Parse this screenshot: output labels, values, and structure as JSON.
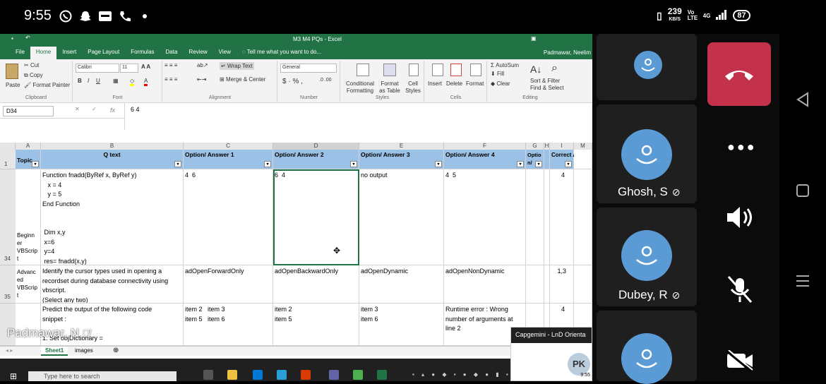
{
  "status": {
    "time": "9:55",
    "speed": "239",
    "speed_unit": "KB/S",
    "network": "Vo LTE",
    "net_type": "4G",
    "battery": "87"
  },
  "excel": {
    "title": "M3 M4 PQs - Excel",
    "tabs": [
      "File",
      "Home",
      "Insert",
      "Page Layout",
      "Formulas",
      "Data",
      "Review",
      "View"
    ],
    "tell_me": "Tell me what you want to do...",
    "user": "Padmawar, Neelim",
    "ribbon": {
      "paste": "Paste",
      "cut": "Cut",
      "copy": "Copy",
      "format_painter": "Format Painter",
      "clipboard": "Clipboard",
      "font_name": "Calibri",
      "font_size": "11",
      "font": "Font",
      "wrap_text": "Wrap Text",
      "merge_center": "Merge & Center",
      "alignment": "Alignment",
      "number_format": "General",
      "number": "Number",
      "cond_format": "Conditional Formatting",
      "format_table": "Format as Table",
      "cell_styles": "Cell Styles",
      "styles": "Styles",
      "insert": "Insert",
      "delete": "Delete",
      "format": "Format",
      "cells": "Cells",
      "autosum": "AutoSum",
      "fill": "Fill",
      "clear": "Clear",
      "sort_filter": "Sort & Filter",
      "find_select": "Find & Select",
      "editing": "Editing"
    },
    "name_box": "D34",
    "fx": "fx",
    "formula": "6 4",
    "columns": [
      "A",
      "B",
      "C",
      "D",
      "E",
      "F",
      "G",
      "H",
      "I",
      "M"
    ],
    "headers": {
      "topic": "Topic",
      "q_text": "Q text",
      "opt1": "Option/ Answer 1",
      "opt2": "Option/ Answer 2",
      "opt3": "Option/ Answer 3",
      "opt4": "Option/ Answer 4",
      "g": "Optio n/",
      "correct": "Correct Answer"
    },
    "rows": [
      {
        "num": "34",
        "topic": "Beginn er VBScrip t",
        "q": "Function fnadd(ByRef x, ByRef y)\n   x = 4\n   y = 5\nEnd Function\n\n\n Dim x,y\n x=6\n y=4\n res= fnadd(x,y)\n msgbox (x & \" \" & y)",
        "o1": "4  6",
        "o2": "6  4",
        "o3": "no output",
        "o4": "4  5",
        "ans": "4"
      },
      {
        "num": "35",
        "topic": "Advanc ed VBScrip t",
        "q": "Identify the cursor types used in opening a\nrecordset during database connectivity using\nvbscript.\n(Select any two)",
        "o1": "adOpenForwardOnly",
        "o2": "adOpenBackwardOnly",
        "o3": "adOpenDynamic",
        "o4": "adOpenNonDynamic",
        "ans": "1,3"
      },
      {
        "num": "",
        "topic": "",
        "q": "Predict the output of the following code\nsnippet :\n\n1. Set objDictionary =",
        "o1": "item 2   item 3\nitem 5   item 6",
        "o2": "item 2\nitem 5",
        "o3": "item 3\nitem 6",
        "o4": "Runtime error : Wrong\nnumber of arguments at\nline 2",
        "ans": "4"
      }
    ],
    "sheet_tabs": [
      "Sheet1",
      "images"
    ],
    "row1_num": "1"
  },
  "taskbar": {
    "search": "Type here to search",
    "presenter": "Padmawar, N"
  },
  "capwin": {
    "title": "Capgemini - LnD Orienta",
    "initials": "PK",
    "time": "9:55"
  },
  "teams": {
    "participants": [
      {
        "name": ""
      },
      {
        "name": "Ghosh, S"
      },
      {
        "name": "Dubey, R"
      },
      {
        "name": ""
      }
    ]
  }
}
